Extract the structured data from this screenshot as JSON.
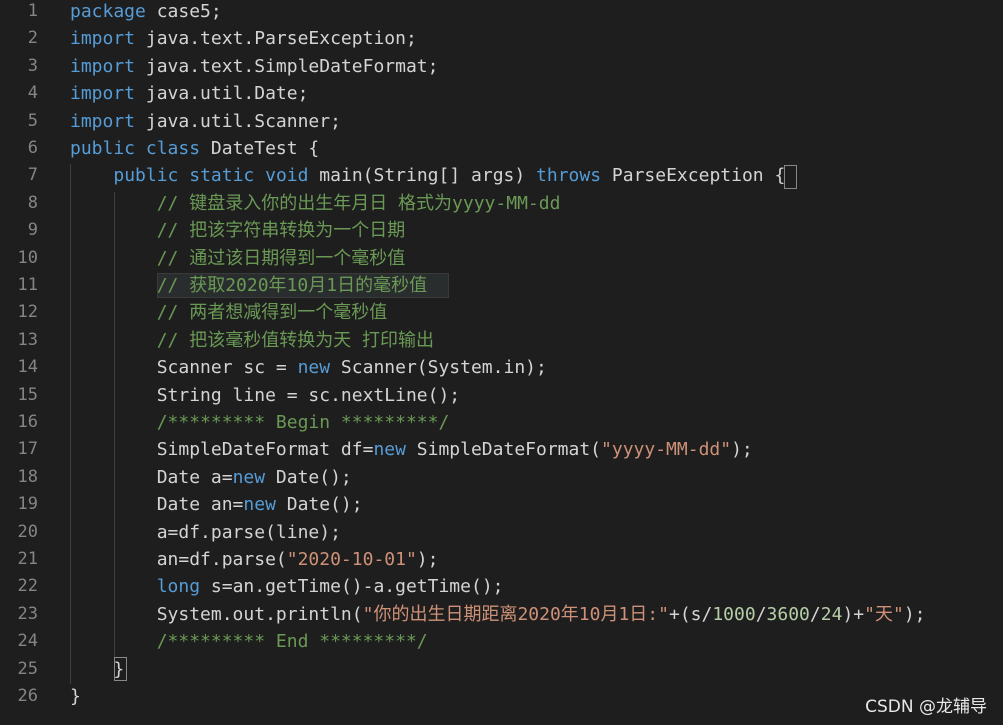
{
  "editor": {
    "lines": [
      {
        "num": "1",
        "tokens": [
          {
            "t": "package",
            "c": "kw"
          },
          {
            "t": " case5;",
            "c": "txt"
          }
        ]
      },
      {
        "num": "2",
        "tokens": [
          {
            "t": "import",
            "c": "kw"
          },
          {
            "t": " java.text.ParseException;",
            "c": "txt"
          }
        ]
      },
      {
        "num": "3",
        "tokens": [
          {
            "t": "import",
            "c": "kw"
          },
          {
            "t": " java.text.SimpleDateFormat;",
            "c": "txt"
          }
        ]
      },
      {
        "num": "4",
        "tokens": [
          {
            "t": "import",
            "c": "kw"
          },
          {
            "t": " java.util.Date;",
            "c": "txt"
          }
        ]
      },
      {
        "num": "5",
        "tokens": [
          {
            "t": "import",
            "c": "kw"
          },
          {
            "t": " java.util.Scanner;",
            "c": "txt"
          }
        ]
      },
      {
        "num": "6",
        "tokens": [
          {
            "t": "public",
            "c": "kw"
          },
          {
            "t": " ",
            "c": "txt"
          },
          {
            "t": "class",
            "c": "kw"
          },
          {
            "t": " DateTest {",
            "c": "txt"
          }
        ]
      },
      {
        "num": "7",
        "tokens": [
          {
            "t": "    ",
            "c": "txt"
          },
          {
            "t": "public",
            "c": "kw"
          },
          {
            "t": " ",
            "c": "txt"
          },
          {
            "t": "static",
            "c": "kw"
          },
          {
            "t": " ",
            "c": "txt"
          },
          {
            "t": "void",
            "c": "kw"
          },
          {
            "t": " main(String[] args) ",
            "c": "txt"
          },
          {
            "t": "throws",
            "c": "kw"
          },
          {
            "t": " ParseException {",
            "c": "txt"
          }
        ]
      },
      {
        "num": "8",
        "tokens": [
          {
            "t": "        // 键盘录入你的出生年月日 格式为yyyy-MM-dd",
            "c": "cmt"
          }
        ]
      },
      {
        "num": "9",
        "tokens": [
          {
            "t": "        // 把该字符串转换为一个日期",
            "c": "cmt"
          }
        ]
      },
      {
        "num": "10",
        "tokens": [
          {
            "t": "        // 通过该日期得到一个毫秒值",
            "c": "cmt"
          }
        ]
      },
      {
        "num": "11",
        "tokens": [
          {
            "t": "        // 获取2020年10月1日的毫秒值",
            "c": "cmt"
          }
        ]
      },
      {
        "num": "12",
        "tokens": [
          {
            "t": "        // 两者想减得到一个毫秒值",
            "c": "cmt"
          }
        ]
      },
      {
        "num": "13",
        "tokens": [
          {
            "t": "        // 把该毫秒值转换为天 打印输出",
            "c": "cmt"
          }
        ]
      },
      {
        "num": "14",
        "tokens": [
          {
            "t": "        Scanner sc = ",
            "c": "txt"
          },
          {
            "t": "new",
            "c": "kw"
          },
          {
            "t": " Scanner(System.in);",
            "c": "txt"
          }
        ]
      },
      {
        "num": "15",
        "tokens": [
          {
            "t": "        String line = sc.nextLine();",
            "c": "txt"
          }
        ]
      },
      {
        "num": "16",
        "tokens": [
          {
            "t": "        /********* Begin *********/",
            "c": "cmt"
          }
        ]
      },
      {
        "num": "17",
        "tokens": [
          {
            "t": "        SimpleDateFormat df=",
            "c": "txt"
          },
          {
            "t": "new",
            "c": "kw"
          },
          {
            "t": " SimpleDateFormat(",
            "c": "txt"
          },
          {
            "t": "\"yyyy-MM-dd\"",
            "c": "str"
          },
          {
            "t": ");",
            "c": "txt"
          }
        ]
      },
      {
        "num": "18",
        "tokens": [
          {
            "t": "        Date a=",
            "c": "txt"
          },
          {
            "t": "new",
            "c": "kw"
          },
          {
            "t": " Date();",
            "c": "txt"
          }
        ]
      },
      {
        "num": "19",
        "tokens": [
          {
            "t": "        Date an=",
            "c": "txt"
          },
          {
            "t": "new",
            "c": "kw"
          },
          {
            "t": " Date();",
            "c": "txt"
          }
        ]
      },
      {
        "num": "20",
        "tokens": [
          {
            "t": "        a=df.parse(line);",
            "c": "txt"
          }
        ]
      },
      {
        "num": "21",
        "tokens": [
          {
            "t": "        an=df.parse(",
            "c": "txt"
          },
          {
            "t": "\"2020-10-01\"",
            "c": "str"
          },
          {
            "t": ");",
            "c": "txt"
          }
        ]
      },
      {
        "num": "22",
        "tokens": [
          {
            "t": "        ",
            "c": "txt"
          },
          {
            "t": "long",
            "c": "kw"
          },
          {
            "t": " s=an.getTime()-a.getTime();",
            "c": "txt"
          }
        ]
      },
      {
        "num": "23",
        "tokens": [
          {
            "t": "        System.out.println(",
            "c": "txt"
          },
          {
            "t": "\"你的出生日期距离2020年10月1日:\"",
            "c": "str"
          },
          {
            "t": "+(s/",
            "c": "txt"
          },
          {
            "t": "1000",
            "c": "num"
          },
          {
            "t": "/",
            "c": "txt"
          },
          {
            "t": "3600",
            "c": "num"
          },
          {
            "t": "/",
            "c": "txt"
          },
          {
            "t": "24",
            "c": "num"
          },
          {
            "t": ")+",
            "c": "txt"
          },
          {
            "t": "\"天\"",
            "c": "str"
          },
          {
            "t": ");",
            "c": "txt"
          }
        ]
      },
      {
        "num": "24",
        "tokens": [
          {
            "t": "        /********* End *********/",
            "c": "cmt"
          }
        ]
      },
      {
        "num": "25",
        "tokens": [
          {
            "t": "    }",
            "c": "txt"
          }
        ]
      },
      {
        "num": "26",
        "tokens": [
          {
            "t": "}",
            "c": "txt"
          }
        ]
      }
    ],
    "colors": {
      "background": "#1e1e1e",
      "keyword": "#569cd6",
      "string": "#ce9178",
      "number": "#b5cea8",
      "comment": "#6a9955",
      "text": "#d4d4d4",
      "line_number": "#858585"
    }
  },
  "watermark": "CSDN @龙辅导"
}
